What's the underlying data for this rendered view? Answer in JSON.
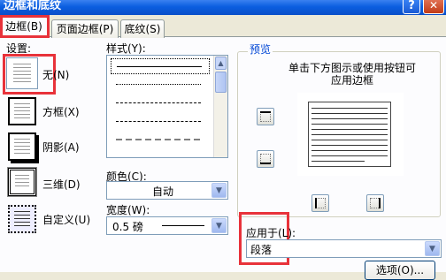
{
  "window": {
    "title": "边框和底纹",
    "help_label": "?",
    "close_label": "✕"
  },
  "tabs": [
    {
      "label": "边框(B)",
      "active": true
    },
    {
      "label": "页面边框(P)",
      "active": false
    },
    {
      "label": "底纹(S)",
      "active": false
    }
  ],
  "settings": {
    "group_label": "设置:",
    "items": [
      {
        "label": "无(N)",
        "icon": "no-border-icon",
        "selected": true
      },
      {
        "label": "方框(X)",
        "icon": "box-border-icon",
        "selected": false
      },
      {
        "label": "阴影(A)",
        "icon": "shadow-border-icon",
        "selected": false
      },
      {
        "label": "三维(D)",
        "icon": "3d-border-icon",
        "selected": false
      },
      {
        "label": "自定义(U)",
        "icon": "custom-border-icon",
        "selected": false
      }
    ]
  },
  "style": {
    "label": "样式(Y):",
    "items": [
      "solid",
      "dotted",
      "dashed-small",
      "dashed",
      "dashed-large",
      "dash-dot"
    ]
  },
  "color": {
    "label": "颜色(C):",
    "value": "自动"
  },
  "width": {
    "label": "宽度(W):",
    "value": "0.5 磅"
  },
  "preview": {
    "group_label": "预览",
    "hint_line1": "单击下方图示或使用按钮可",
    "hint_line2": "应用边框"
  },
  "apply_to": {
    "label": "应用于(L):",
    "value": "段落"
  },
  "options_button": "选项(O)...",
  "colors": {
    "title_bar": "#0b5ee0",
    "highlight": "#e8323a",
    "accent": "#0046d5"
  }
}
